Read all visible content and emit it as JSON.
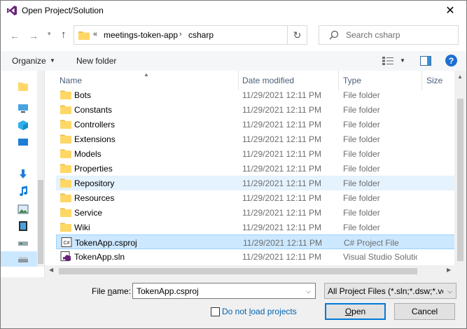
{
  "window": {
    "title": "Open Project/Solution"
  },
  "address": {
    "overflow_glyph": "«",
    "breadcrumbs": [
      "meetings-token-app",
      "csharp"
    ],
    "separator": "›"
  },
  "search": {
    "placeholder": "Search csharp"
  },
  "toolbar": {
    "organize_label": "Organize",
    "new_folder_label": "New folder"
  },
  "columns": {
    "name": "Name",
    "date": "Date modified",
    "type": "Type",
    "size": "Size"
  },
  "files": [
    {
      "name": "Bots",
      "date": "11/29/2021 12:11 PM",
      "type": "File folder",
      "kind": "folder"
    },
    {
      "name": "Constants",
      "date": "11/29/2021 12:11 PM",
      "type": "File folder",
      "kind": "folder"
    },
    {
      "name": "Controllers",
      "date": "11/29/2021 12:11 PM",
      "type": "File folder",
      "kind": "folder"
    },
    {
      "name": "Extensions",
      "date": "11/29/2021 12:11 PM",
      "type": "File folder",
      "kind": "folder"
    },
    {
      "name": "Models",
      "date": "11/29/2021 12:11 PM",
      "type": "File folder",
      "kind": "folder"
    },
    {
      "name": "Properties",
      "date": "11/29/2021 12:11 PM",
      "type": "File folder",
      "kind": "folder"
    },
    {
      "name": "Repository",
      "date": "11/29/2021 12:11 PM",
      "type": "File folder",
      "kind": "folder",
      "state": "hover"
    },
    {
      "name": "Resources",
      "date": "11/29/2021 12:11 PM",
      "type": "File folder",
      "kind": "folder"
    },
    {
      "name": "Service",
      "date": "11/29/2021 12:11 PM",
      "type": "File folder",
      "kind": "folder"
    },
    {
      "name": "Wiki",
      "date": "11/29/2021 12:11 PM",
      "type": "File folder",
      "kind": "folder"
    },
    {
      "name": "TokenApp.csproj",
      "date": "11/29/2021 12:11 PM",
      "type": "C# Project File",
      "kind": "csproj",
      "state": "selected"
    },
    {
      "name": "TokenApp.sln",
      "date": "11/29/2021 12:11 PM",
      "type": "Visual Studio Solution",
      "kind": "sln"
    }
  ],
  "bottom": {
    "file_name_label_pre": "File ",
    "file_name_label_u": "n",
    "file_name_label_post": "ame:",
    "file_name_value": "TokenApp.csproj",
    "file_type_value": "All Project Files (*.sln;*.dsw;*.vcxproj;...)",
    "checkbox_label_pre": "Do not ",
    "checkbox_label_u": "l",
    "checkbox_label_post": "oad projects",
    "open_label_u": "O",
    "open_label_post": "pen",
    "cancel_label": "Cancel"
  },
  "colors": {
    "folder": "#ffd766",
    "accent": "#0078d7",
    "selected_bg": "#cce8ff",
    "hover_bg": "#e5f3ff",
    "link": "#0063b1"
  },
  "icons": {
    "nav": [
      "quick-access-icon",
      "this-pc-icon",
      "3d-objects-icon",
      "desktop-icon",
      "downloads-icon",
      "music-icon",
      "pictures-icon",
      "videos-icon",
      "network-drive-icon",
      "local-disk-icon"
    ]
  }
}
